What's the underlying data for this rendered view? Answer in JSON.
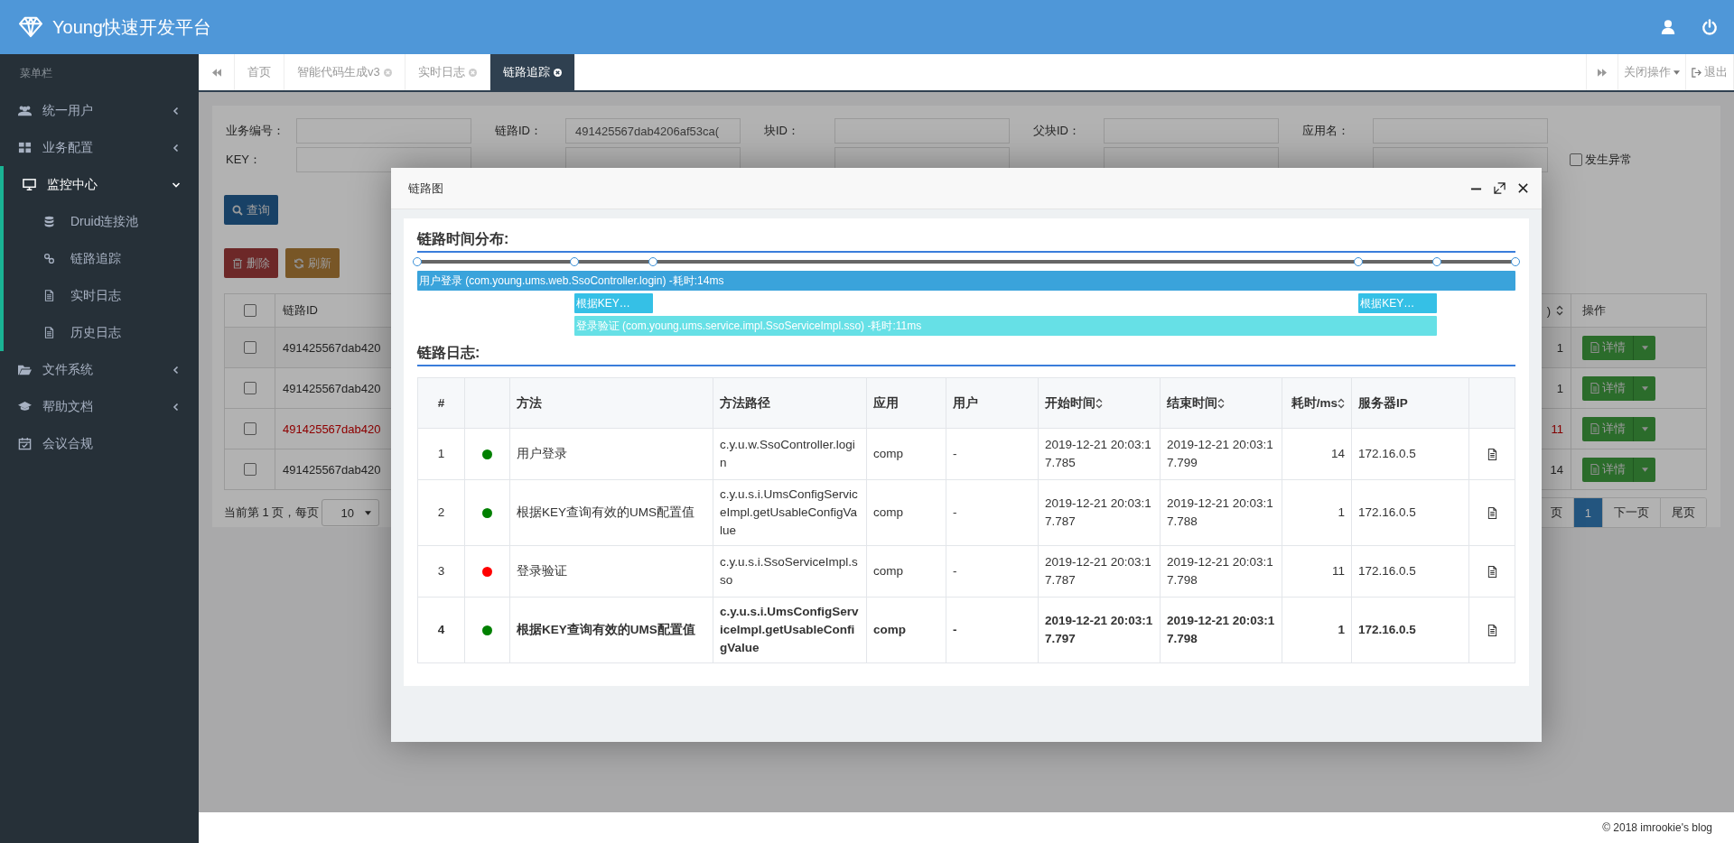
{
  "header": {
    "title": "Young快速开发平台"
  },
  "sidebar": {
    "caption": "菜单栏",
    "items": [
      {
        "label": "统一用户",
        "expanded": false
      },
      {
        "label": "业务配置",
        "expanded": false
      },
      {
        "label": "监控中心",
        "expanded": true,
        "children": [
          {
            "label": "Druid连接池"
          },
          {
            "label": "链路追踪"
          },
          {
            "label": "实时日志"
          },
          {
            "label": "历史日志"
          }
        ]
      },
      {
        "label": "文件系统",
        "expanded": false
      },
      {
        "label": "帮助文档",
        "expanded": false
      },
      {
        "label": "会议合规"
      }
    ]
  },
  "tabs": [
    {
      "label": "首页",
      "closable": false,
      "selected": false
    },
    {
      "label": "智能代码生成v3",
      "closable": true,
      "selected": false
    },
    {
      "label": "实时日志",
      "closable": true,
      "selected": false
    },
    {
      "label": "链路追踪",
      "closable": true,
      "selected": true
    }
  ],
  "tab_tools": {
    "close_menu": "关闭操作",
    "logout": "退出"
  },
  "search_form": {
    "fields": [
      {
        "label": "业务编号："
      },
      {
        "label": "链路ID：",
        "value": "491425567dab4206af53ca("
      },
      {
        "label": "块ID："
      },
      {
        "label": "父块ID："
      },
      {
        "label": "应用名："
      }
    ],
    "key_label": "KEY：",
    "error_checkbox": {
      "label": "发生异常",
      "checked": false
    },
    "query_button": "查询"
  },
  "toolbar": {
    "delete": "删除",
    "refresh": "刷新"
  },
  "table": {
    "select_all_checked": false,
    "columns": [
      "链路ID",
      ")",
      "操作"
    ],
    "rows": [
      {
        "checked": false,
        "id": "491425567dab420",
        "count": "1",
        "error": false,
        "action": "详情"
      },
      {
        "checked": false,
        "id": "491425567dab420",
        "count": "1",
        "error": false,
        "action": "详情"
      },
      {
        "checked": false,
        "id": "491425567dab420",
        "count": "11",
        "error": true,
        "action": "详情"
      },
      {
        "checked": false,
        "id": "491425567dab420",
        "count": "14",
        "error": false,
        "action": "详情"
      }
    ]
  },
  "pagination": {
    "info": "当前第 1 页，每页",
    "page_size": "10",
    "pages": [
      {
        "label": "页",
        "selected": false
      },
      {
        "label": "1",
        "selected": true
      },
      {
        "label": "下一页",
        "selected": false
      },
      {
        "label": "尾页",
        "selected": false
      }
    ]
  },
  "footer": "© 2018 imrookie's blog",
  "modal": {
    "title": "链路图",
    "timeline": {
      "title": "链路时间分布:",
      "spans": [
        {
          "label": "用户登录 (com.young.ums.web.SsoController.login) -耗时:14ms",
          "color": "#3aa3db"
        },
        {
          "label": "根据KEY…",
          "color": "#35c0e6"
        },
        {
          "label": "登录验证 (com.young.ums.service.impl.SsoServiceImpl.sso) -耗时:11ms",
          "color": "#66e0e6"
        },
        {
          "label": "根据KEY…",
          "color": "#35c0e6"
        }
      ]
    },
    "log": {
      "title": "链路日志:",
      "columns": [
        {
          "label": "#",
          "sortable": false
        },
        {
          "label": "方法",
          "sortable": false
        },
        {
          "label": "方法路径",
          "sortable": false
        },
        {
          "label": "应用",
          "sortable": false
        },
        {
          "label": "用户",
          "sortable": false
        },
        {
          "label": "开始时间",
          "sortable": true
        },
        {
          "label": "结束时间",
          "sortable": true
        },
        {
          "label": "耗时/ms",
          "sortable": true
        },
        {
          "label": "服务器IP",
          "sortable": false
        }
      ],
      "rows": [
        {
          "no": "1",
          "color": "#008000",
          "method": "用户登录",
          "path": "c.y.u.w.SsoController.login",
          "app": "comp",
          "user": "-",
          "start": "2019-12-21 20:03:17.785",
          "end": "2019-12-21 20:03:17.799",
          "duration": "14",
          "ip": "172.16.0.5",
          "highlighted": false
        },
        {
          "no": "2",
          "color": "#008000",
          "method": "根据KEY查询有效的UMS配置值",
          "path": "c.y.u.s.i.UmsConfigServiceImpl.getUsableConfigValue",
          "app": "comp",
          "user": "-",
          "start": "2019-12-21 20:03:17.787",
          "end": "2019-12-21 20:03:17.788",
          "duration": "1",
          "ip": "172.16.0.5",
          "highlighted": false
        },
        {
          "no": "3",
          "color": "#ff0000",
          "method": "登录验证",
          "path": "c.y.u.s.i.SsoServiceImpl.sso",
          "app": "comp",
          "user": "-",
          "start": "2019-12-21 20:03:17.787",
          "end": "2019-12-21 20:03:17.798",
          "duration": "11",
          "ip": "172.16.0.5",
          "highlighted": false
        },
        {
          "no": "4",
          "color": "#008000",
          "method": "根据KEY查询有效的UMS配置值",
          "path": "c.y.u.s.i.UmsConfigServiceImpl.getUsableConfigValue",
          "app": "comp",
          "user": "-",
          "start": "2019-12-21 20:03:17.797",
          "end": "2019-12-21 20:03:17.798",
          "duration": "1",
          "ip": "172.16.0.5",
          "highlighted": true
        }
      ]
    }
  }
}
